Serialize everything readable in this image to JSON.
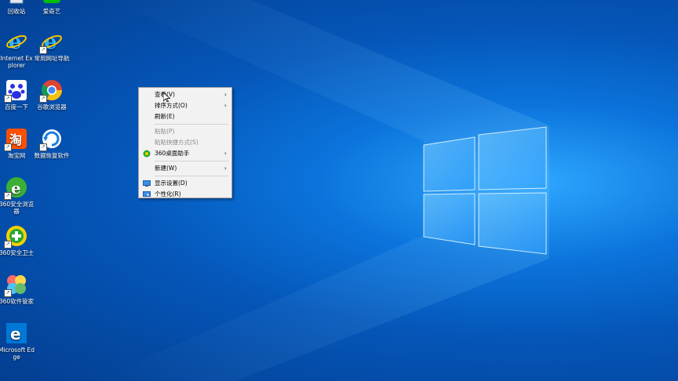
{
  "desktop": {
    "icons": [
      {
        "label": "回收站",
        "icon": "recycle-bin-icon"
      },
      {
        "label": "爱奇艺",
        "icon": "iqiyi-icon"
      },
      {
        "label": "Internet Explorer",
        "icon": "internet-explorer-icon"
      },
      {
        "label": "常用网址导航",
        "icon": "internet-explorer-icon"
      },
      {
        "label": "百度一下",
        "icon": "baidu-paw-icon"
      },
      {
        "label": "谷歌浏览器",
        "icon": "chrome-icon"
      },
      {
        "label": "淘宝网",
        "icon": "taobao-icon"
      },
      {
        "label": "数据恢复软件",
        "icon": "data-recovery-icon"
      },
      {
        "label": "360安全浏览器",
        "icon": "360-browser-icon"
      },
      {
        "label": "360安全卫士",
        "icon": "360-safeguard-icon"
      },
      {
        "label": "360软件管家",
        "icon": "360-software-manager-icon"
      },
      {
        "label": "Microsoft Edge",
        "icon": "edge-icon"
      }
    ]
  },
  "context_menu": {
    "items": [
      {
        "label": "查看(V)",
        "has_submenu": true,
        "disabled": false
      },
      {
        "label": "排序方式(O)",
        "has_submenu": true,
        "disabled": false
      },
      {
        "label": "刷新(E)",
        "has_submenu": false,
        "disabled": false
      },
      {
        "label": "粘贴(P)",
        "has_submenu": false,
        "disabled": true
      },
      {
        "label": "粘贴快捷方式(S)",
        "has_submenu": false,
        "disabled": true
      },
      {
        "label": "360桌面助手",
        "has_submenu": true,
        "disabled": false,
        "icon": "360-desktop-icon"
      },
      {
        "label": "新建(W)",
        "has_submenu": true,
        "disabled": false
      },
      {
        "label": "显示设置(D)",
        "has_submenu": false,
        "disabled": false,
        "icon": "display-settings-icon"
      },
      {
        "label": "个性化(R)",
        "has_submenu": false,
        "disabled": false,
        "icon": "personalize-icon"
      }
    ]
  },
  "colors": {
    "background": "#0556b8",
    "menu_bg": "#f2f2f2",
    "menu_disabled": "#8a8a8a"
  }
}
